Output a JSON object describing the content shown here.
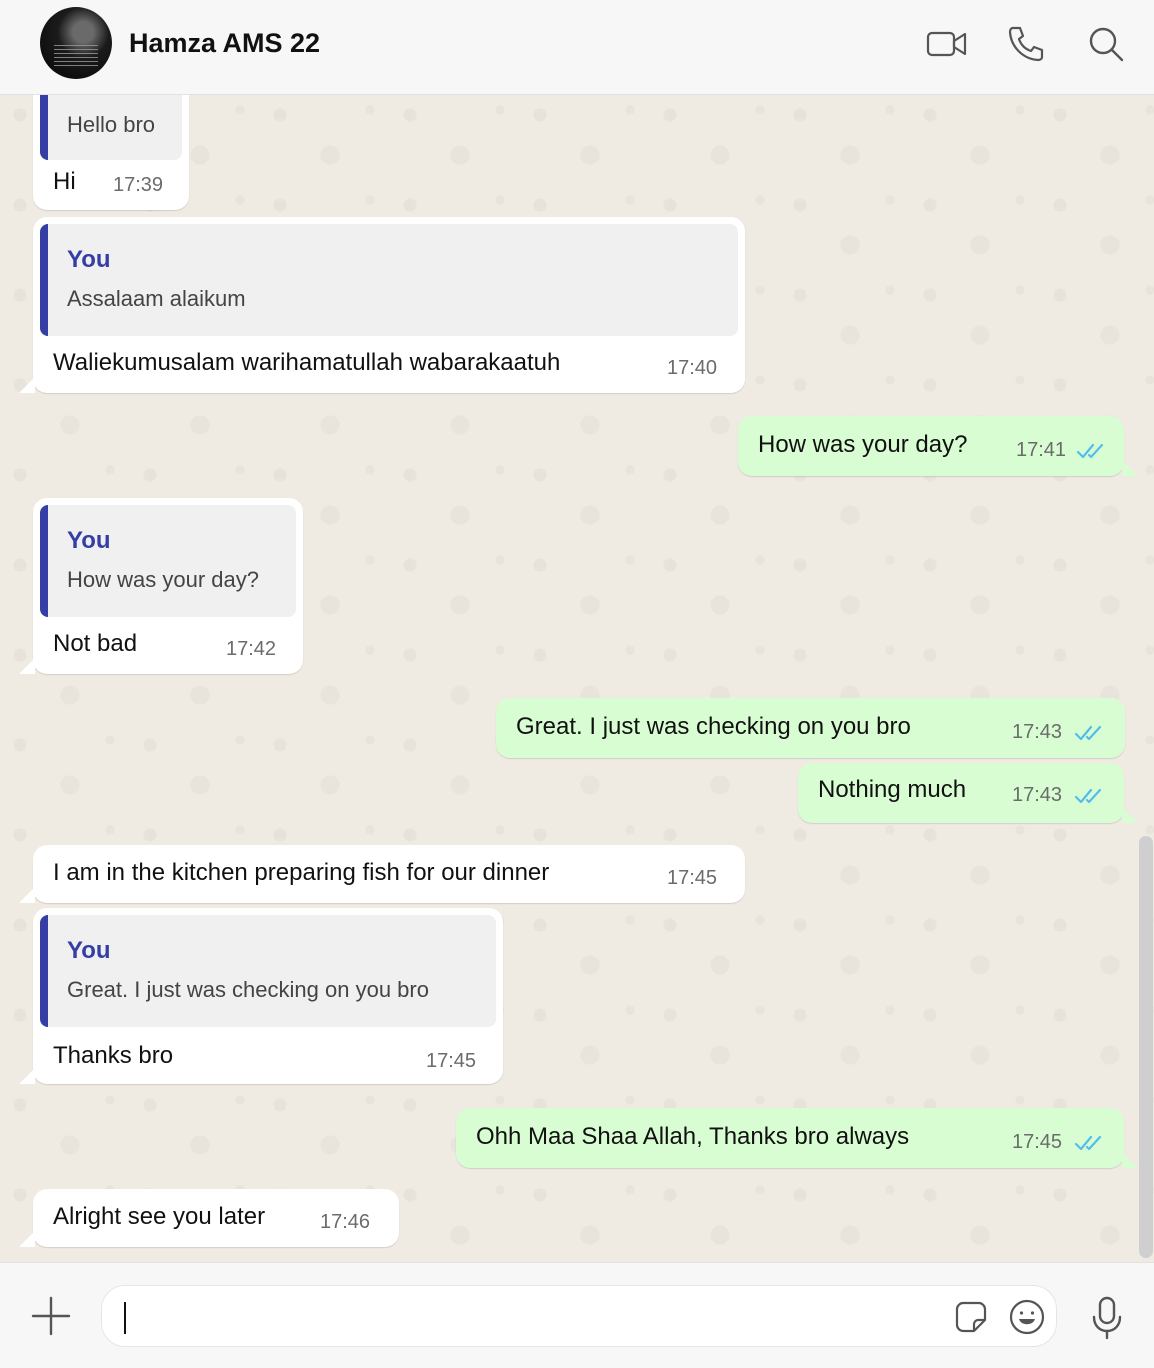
{
  "header": {
    "contact_name": "Hamza AMS 22",
    "icons": [
      "video-call-icon",
      "voice-call-icon",
      "search-icon"
    ]
  },
  "messages": [
    {
      "direction": "in",
      "quote_text": "Hello bro",
      "text": "Hi",
      "time": "17:39"
    },
    {
      "direction": "in",
      "quote_name": "You",
      "quote_text": "Assalaam alaikum",
      "text": "Waliekumusalam warihamatullah wabarakaatuh",
      "time": "17:40"
    },
    {
      "direction": "out",
      "text": "How was your day?",
      "time": "17:41",
      "status": "read"
    },
    {
      "direction": "in",
      "quote_name": "You",
      "quote_text": "How was your day?",
      "text": "Not bad",
      "time": "17:42"
    },
    {
      "direction": "out",
      "text": "Great. I just was checking on you bro",
      "time": "17:43",
      "status": "read"
    },
    {
      "direction": "out",
      "text": "Nothing much",
      "time": "17:43",
      "status": "read"
    },
    {
      "direction": "in",
      "text": "I am in the kitchen preparing fish for our dinner",
      "time": "17:45"
    },
    {
      "direction": "in",
      "quote_name": "You",
      "quote_text": "Great. I just was checking on you bro",
      "text": "Thanks bro",
      "time": "17:45"
    },
    {
      "direction": "out",
      "text": "Ohh Maa Shaa Allah, Thanks bro always",
      "time": "17:45",
      "status": "read"
    },
    {
      "direction": "in",
      "text": "Alright see you later",
      "time": "17:46"
    }
  ],
  "composer": {
    "value": "",
    "icons": [
      "plus-icon",
      "sticker-icon",
      "emoji-icon",
      "microphone-icon"
    ]
  },
  "colors": {
    "quote_accent": "#353ea5",
    "outgoing_bubble": "#d9fdd3",
    "incoming_bubble": "#ffffff",
    "read_ticks": "#53bdeb",
    "chat_background": "#efeae2"
  }
}
